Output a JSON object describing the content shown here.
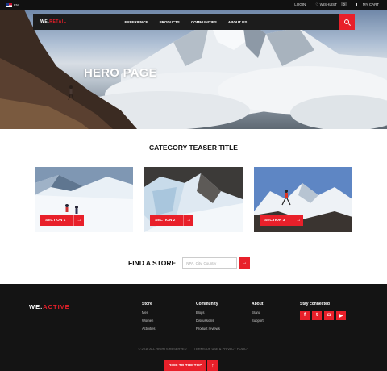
{
  "topbar": {
    "language": "EN",
    "login": "LOGIN",
    "wishlist": "WISHLIST",
    "wishlist_count": "0",
    "cart": "MY CART"
  },
  "nav": {
    "logo_main": "WE.",
    "logo_accent": "RETAIL",
    "links": [
      "EXPERIENCE",
      "PRODUCTS",
      "COMMUNITIES",
      "ABOUT US"
    ],
    "search_icon": "search-icon"
  },
  "hero": {
    "title": "HERO PAGE"
  },
  "category": {
    "title": "CATEGORY TEASER TITLE",
    "cards": [
      {
        "label": "SECTION 1",
        "arrow": "→"
      },
      {
        "label": "SECTION 2",
        "arrow": "→"
      },
      {
        "label": "SECTION 3",
        "arrow": "→"
      }
    ]
  },
  "store": {
    "title": "FIND A STORE",
    "placeholder": "NPA, City, Country",
    "go": "→"
  },
  "footer": {
    "logo_main": "WE.",
    "logo_accent": "ACTIVE",
    "columns": [
      {
        "title": "Store",
        "links": [
          "Men",
          "Women",
          "Activities"
        ]
      },
      {
        "title": "Community",
        "links": [
          "Blogs",
          "Discussions",
          "Product reviews"
        ]
      },
      {
        "title": "About",
        "links": [
          "Brand",
          "Support"
        ]
      }
    ],
    "stay_connected": "Stay connected",
    "social": [
      {
        "icon": "facebook-icon",
        "glyph": "f"
      },
      {
        "icon": "twitter-icon",
        "glyph": "t"
      },
      {
        "icon": "instagram-icon",
        "glyph": "◘"
      },
      {
        "icon": "youtube-icon",
        "glyph": "▶"
      }
    ],
    "copyright": "© 2016 ALL RIGHTS RESERVED",
    "terms": "TERMS OF USE & PRIVACY POLICY",
    "top_button": "RIDE TO THE TOP",
    "top_arrow": "↑"
  },
  "colors": {
    "accent": "#e8202a",
    "dark": "#141414"
  }
}
